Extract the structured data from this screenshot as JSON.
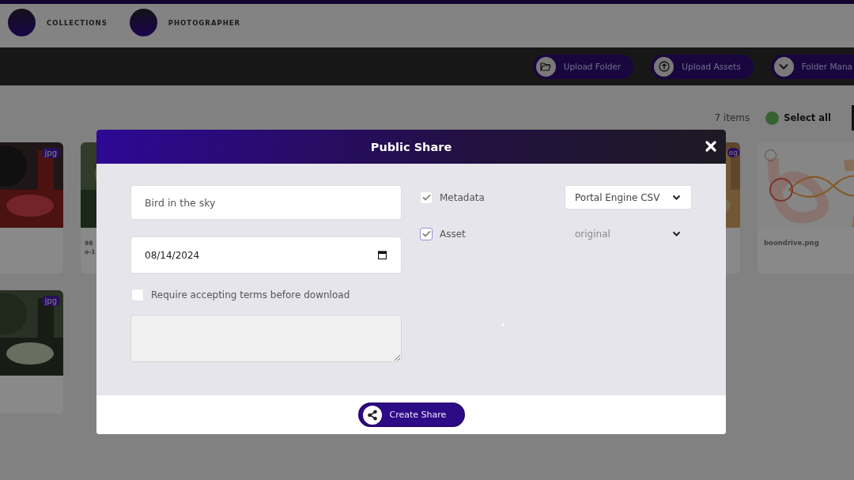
{
  "nav": {
    "items": [
      {
        "label": "COLLECTIONS"
      },
      {
        "label": "PHOTOGRAPHER"
      }
    ]
  },
  "toolbar": {
    "buttons": [
      {
        "label": "Upload Folder"
      },
      {
        "label": "Upload Assets"
      },
      {
        "label": "Folder Mana"
      }
    ]
  },
  "summary": {
    "count": "7 items",
    "select_all": "Select all"
  },
  "cards": [
    {
      "badge": "jpg"
    },
    {
      "name_lines": [
        "98",
        "o-1"
      ]
    },
    {
      "badge": "eg"
    },
    {
      "name_lines": [
        "boondrive.png"
      ],
      "selected": false
    },
    {
      "badge": "jpg"
    }
  ],
  "dialog": {
    "title": "Public Share",
    "name_field": {
      "value": "Bird in the sky"
    },
    "date_field": {
      "value": "08/14/2024"
    },
    "terms": {
      "label": "Require accepting terms before download",
      "checked": false
    },
    "exports": [
      {
        "label": "Metadata",
        "checked": true,
        "format": "Portal Engine CSV",
        "disabled": false
      },
      {
        "label": "Asset",
        "checked": true,
        "format": "original",
        "disabled": true
      }
    ],
    "submit": "Create Share"
  }
}
